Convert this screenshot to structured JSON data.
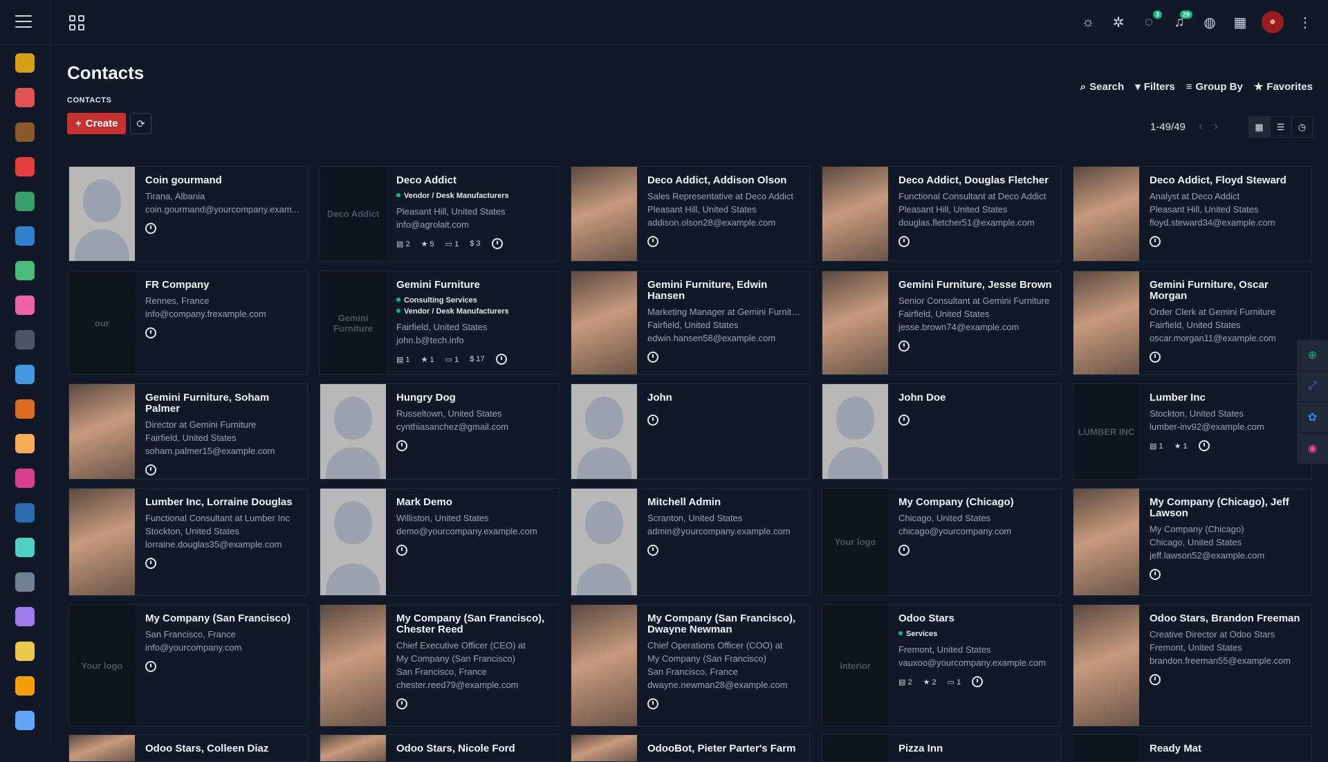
{
  "header": {
    "badges": {
      "chat": "3",
      "notifications": "29"
    }
  },
  "page": {
    "title": "Contacts",
    "breadcrumb": "CONTACTS",
    "create_label": "Create"
  },
  "toolbar": {
    "search": "Search",
    "filters": "Filters",
    "group_by": "Group By",
    "favorites": "Favorites",
    "pager": "1-49/49"
  },
  "sidebar_colors": [
    "#d4a017",
    "#e05252",
    "#8b5a2b",
    "#e53e3e",
    "#38a169",
    "#3182ce",
    "#48bb78",
    "#ed64a6",
    "#4a5568",
    "#4299e1",
    "#dd6b20",
    "#f6ad55",
    "#d53f8c",
    "#2b6cb0",
    "#4fd1c5",
    "#718096",
    "#9f7aea",
    "#ecc94b",
    "#f59e0b",
    "#60a5fa"
  ],
  "cards": [
    {
      "name": "Coin gourmand",
      "lines": [
        "Tirana, Albania",
        "coin.gourmand@yourcompany.exam..."
      ],
      "photo": "gray"
    },
    {
      "name": "Deco Addict",
      "tags": [
        "Vendor / Desk Manufacturers"
      ],
      "lines": [
        "Pleasant Hill, United States",
        "info@agrolait.com"
      ],
      "stats": [
        "2",
        "5",
        "1",
        "3"
      ],
      "photo": "dark",
      "logo": "Deco Addict"
    },
    {
      "name": "Deco Addict, Addison Olson",
      "lines": [
        "Sales Representative at Deco Addict",
        "Pleasant Hill, United States",
        "addison.olson28@example.com"
      ],
      "photo": "face"
    },
    {
      "name": "Deco Addict, Douglas Fletcher",
      "lines": [
        "Functional Consultant at Deco Addict",
        "Pleasant Hill, United States",
        "douglas.fletcher51@example.com"
      ],
      "photo": "face"
    },
    {
      "name": "Deco Addict, Floyd Steward",
      "lines": [
        "Analyst at Deco Addict",
        "Pleasant Hill, United States",
        "floyd.steward34@example.com"
      ],
      "photo": "face"
    },
    {
      "name": "FR Company",
      "lines": [
        "Rennes, France",
        "info@company.frexample.com"
      ],
      "photo": "dark",
      "logo": "our"
    },
    {
      "name": "Gemini Furniture",
      "tags": [
        "Consulting Services",
        "Vendor / Desk Manufacturers"
      ],
      "lines": [
        "Fairfield, United States",
        "john.b@tech.info"
      ],
      "stats": [
        "1",
        "1",
        "1",
        "17"
      ],
      "photo": "dark",
      "logo": "Gemini Furniture"
    },
    {
      "name": "Gemini Furniture, Edwin Hansen",
      "lines": [
        "Marketing Manager at Gemini Furniture",
        "Fairfield, United States",
        "edwin.hansen58@example.com"
      ],
      "photo": "face"
    },
    {
      "name": "Gemini Furniture, Jesse Brown",
      "lines": [
        "Senior Consultant at Gemini Furniture",
        "Fairfield, United States",
        "jesse.brown74@example.com"
      ],
      "photo": "face"
    },
    {
      "name": "Gemini Furniture, Oscar Morgan",
      "lines": [
        "Order Clerk at Gemini Furniture",
        "Fairfield, United States",
        "oscar.morgan11@example.com"
      ],
      "photo": "face"
    },
    {
      "name": "Gemini Furniture, Soham Palmer",
      "lines": [
        "Director at Gemini Furniture",
        "Fairfield, United States",
        "soham.palmer15@example.com"
      ],
      "photo": "face"
    },
    {
      "name": "Hungry Dog",
      "lines": [
        "Russeltown, United States",
        "cynthiasanchez@gmail.com"
      ],
      "photo": "gray"
    },
    {
      "name": "John",
      "lines": [],
      "photo": "gray"
    },
    {
      "name": "John Doe",
      "lines": [],
      "photo": "gray"
    },
    {
      "name": "Lumber Inc",
      "lines": [
        "Stockton, United States",
        "lumber-inv92@example.com"
      ],
      "stats": [
        "1",
        "1"
      ],
      "photo": "dark",
      "logo": "LUMBER INC"
    },
    {
      "name": "Lumber Inc, Lorraine Douglas",
      "lines": [
        "Functional Consultant at Lumber Inc",
        "Stockton, United States",
        "lorraine.douglas35@example.com"
      ],
      "photo": "face"
    },
    {
      "name": "Mark Demo",
      "lines": [
        "Williston, United States",
        "demo@yourcompany.example.com"
      ],
      "photo": "gray"
    },
    {
      "name": "Mitchell Admin",
      "lines": [
        "Scranton, United States",
        "admin@yourcompany.example.com"
      ],
      "photo": "gray"
    },
    {
      "name": "My Company (Chicago)",
      "lines": [
        "Chicago, United States",
        "chicago@yourcompany.com"
      ],
      "photo": "dark",
      "logo": "Your logo"
    },
    {
      "name": "My Company (Chicago), Jeff Lawson",
      "lines": [
        "My Company (Chicago)",
        "Chicago, United States",
        "jeff.lawson52@example.com"
      ],
      "photo": "face"
    },
    {
      "name": "My Company (San Francisco)",
      "lines": [
        "San Francisco, France",
        "info@yourcompany.com"
      ],
      "photo": "dark",
      "logo": "Your logo"
    },
    {
      "name": "My Company (San Francisco), Chester Reed",
      "lines": [
        "Chief Executive Officer (CEO) at",
        "My Company (San Francisco)",
        "San Francisco, France",
        "chester.reed79@example.com"
      ],
      "photo": "face"
    },
    {
      "name": "My Company (San Francisco), Dwayne Newman",
      "lines": [
        "Chief Operations Officer (COO) at",
        "My Company (San Francisco)",
        "San Francisco, France",
        "dwayne.newman28@example.com"
      ],
      "photo": "face"
    },
    {
      "name": "Odoo Stars",
      "tags": [
        "Services"
      ],
      "lines": [
        "Fremont, United States",
        "vauxoo@yourcompany.example.com"
      ],
      "stats": [
        "2",
        "2",
        "1"
      ],
      "photo": "dark",
      "logo": "interior"
    },
    {
      "name": "Odoo Stars, Brandon Freeman",
      "lines": [
        "Creative Director at Odoo Stars",
        "Fremont, United States",
        "brandon.freeman55@example.com"
      ],
      "photo": "face"
    },
    {
      "name": "Odoo Stars, Colleen Diaz",
      "lines": [],
      "photo": "face"
    },
    {
      "name": "Odoo Stars, Nicole Ford",
      "lines": [],
      "photo": "face"
    },
    {
      "name": "OdooBot, Pieter Parter's Farm",
      "lines": [],
      "photo": "face"
    },
    {
      "name": "Pizza Inn",
      "lines": [],
      "photo": "dark"
    },
    {
      "name": "Ready Mat",
      "lines": [],
      "photo": "dark"
    }
  ]
}
